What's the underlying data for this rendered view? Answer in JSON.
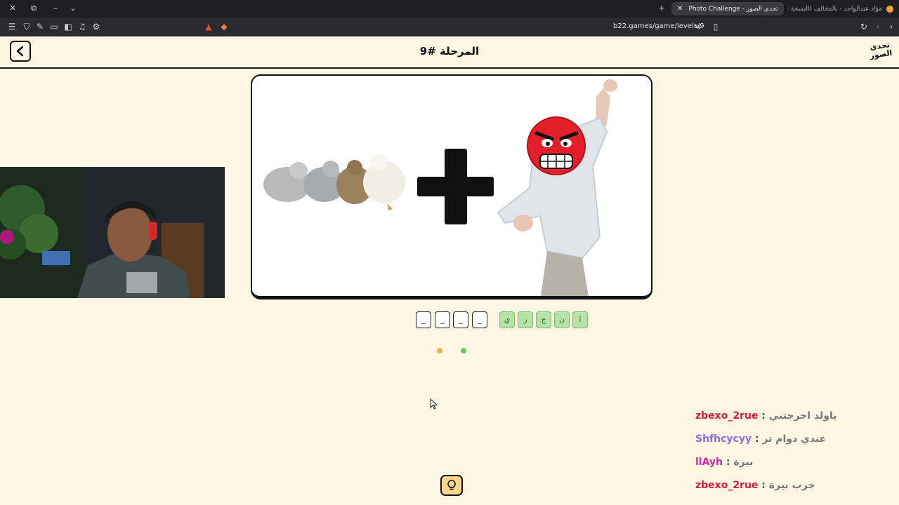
{
  "browser": {
    "active_tab_title": "Photo Challenge - تحدي الصور",
    "other_tab_title": "مؤاد عبدالواحد - بالمخالف (النسخة الأ",
    "url": "b22.games/game/levels/9"
  },
  "game": {
    "level_title": "المرحلة #9",
    "logo_line1": "تحدي",
    "logo_line2": "الصور",
    "slots": [
      "_",
      "_",
      "_",
      "_"
    ],
    "letters": [
      "ي",
      "ر",
      "ج",
      "ن",
      "ا"
    ],
    "dots": [
      {
        "color": "#f0b34a"
      },
      {
        "color": "#5bc86a"
      }
    ]
  },
  "chat": [
    {
      "user": "zbexo_2rue",
      "message": "ياولد احرجتني",
      "color": "#d91a3c"
    },
    {
      "user": "Shfhcycyy",
      "message": "عندي دوام تر",
      "color": "#8a6cf0"
    },
    {
      "user": "llAyh",
      "message": "بيرة",
      "color": "#d42aa0"
    },
    {
      "user": "zbexo_2rue",
      "message": "جرب بيرة",
      "color": "#d91a3c"
    }
  ]
}
